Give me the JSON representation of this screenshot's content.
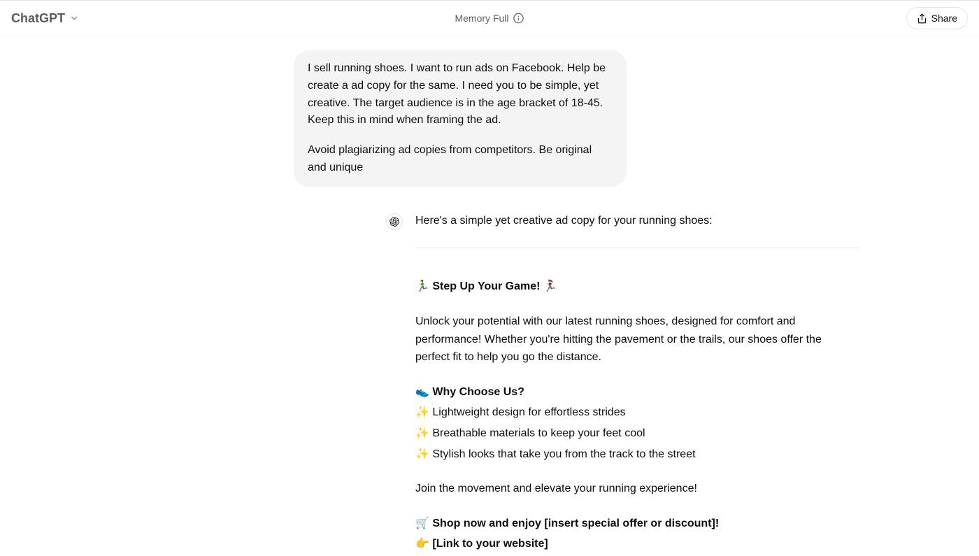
{
  "header": {
    "model_name": "ChatGPT",
    "memory_status": "Memory Full",
    "share_label": "Share"
  },
  "conversation": {
    "user_message": {
      "paragraph1": "I sell running shoes. I want to run ads on Facebook. Help be create a ad copy for the same. I need you to be simple, yet creative. The target audience is in the  age bracket of 18-45. Keep this in mind when framing the ad.",
      "paragraph2": "Avoid plagiarizing ad copies from competitors. Be original and unique"
    },
    "assistant_message": {
      "intro": "Here's a simple yet creative ad copy for your running shoes:",
      "ad": {
        "headline_prefix": "🏃‍♂️ ",
        "headline_bold": "Step Up Your Game!",
        "headline_suffix": " 🏃‍♀️",
        "body": "Unlock your potential with our latest running shoes, designed for comfort and performance! Whether you're hitting the pavement or the trails, our shoes offer the perfect fit to help you go the distance.",
        "why_prefix": "👟 ",
        "why_bold": "Why Choose Us?",
        "bullet1": "✨ Lightweight design for effortless strides",
        "bullet2": "✨ Breathable materials to keep your feet cool",
        "bullet3": "✨ Stylish looks that take you from the track to the street",
        "join": "Join the movement and elevate your running experience!",
        "shop_prefix": "🛒 ",
        "shop_bold": "Shop now and enjoy [insert special offer or discount]!",
        "link_prefix": "👉 ",
        "link_bold": "[Link to your website]"
      }
    }
  }
}
